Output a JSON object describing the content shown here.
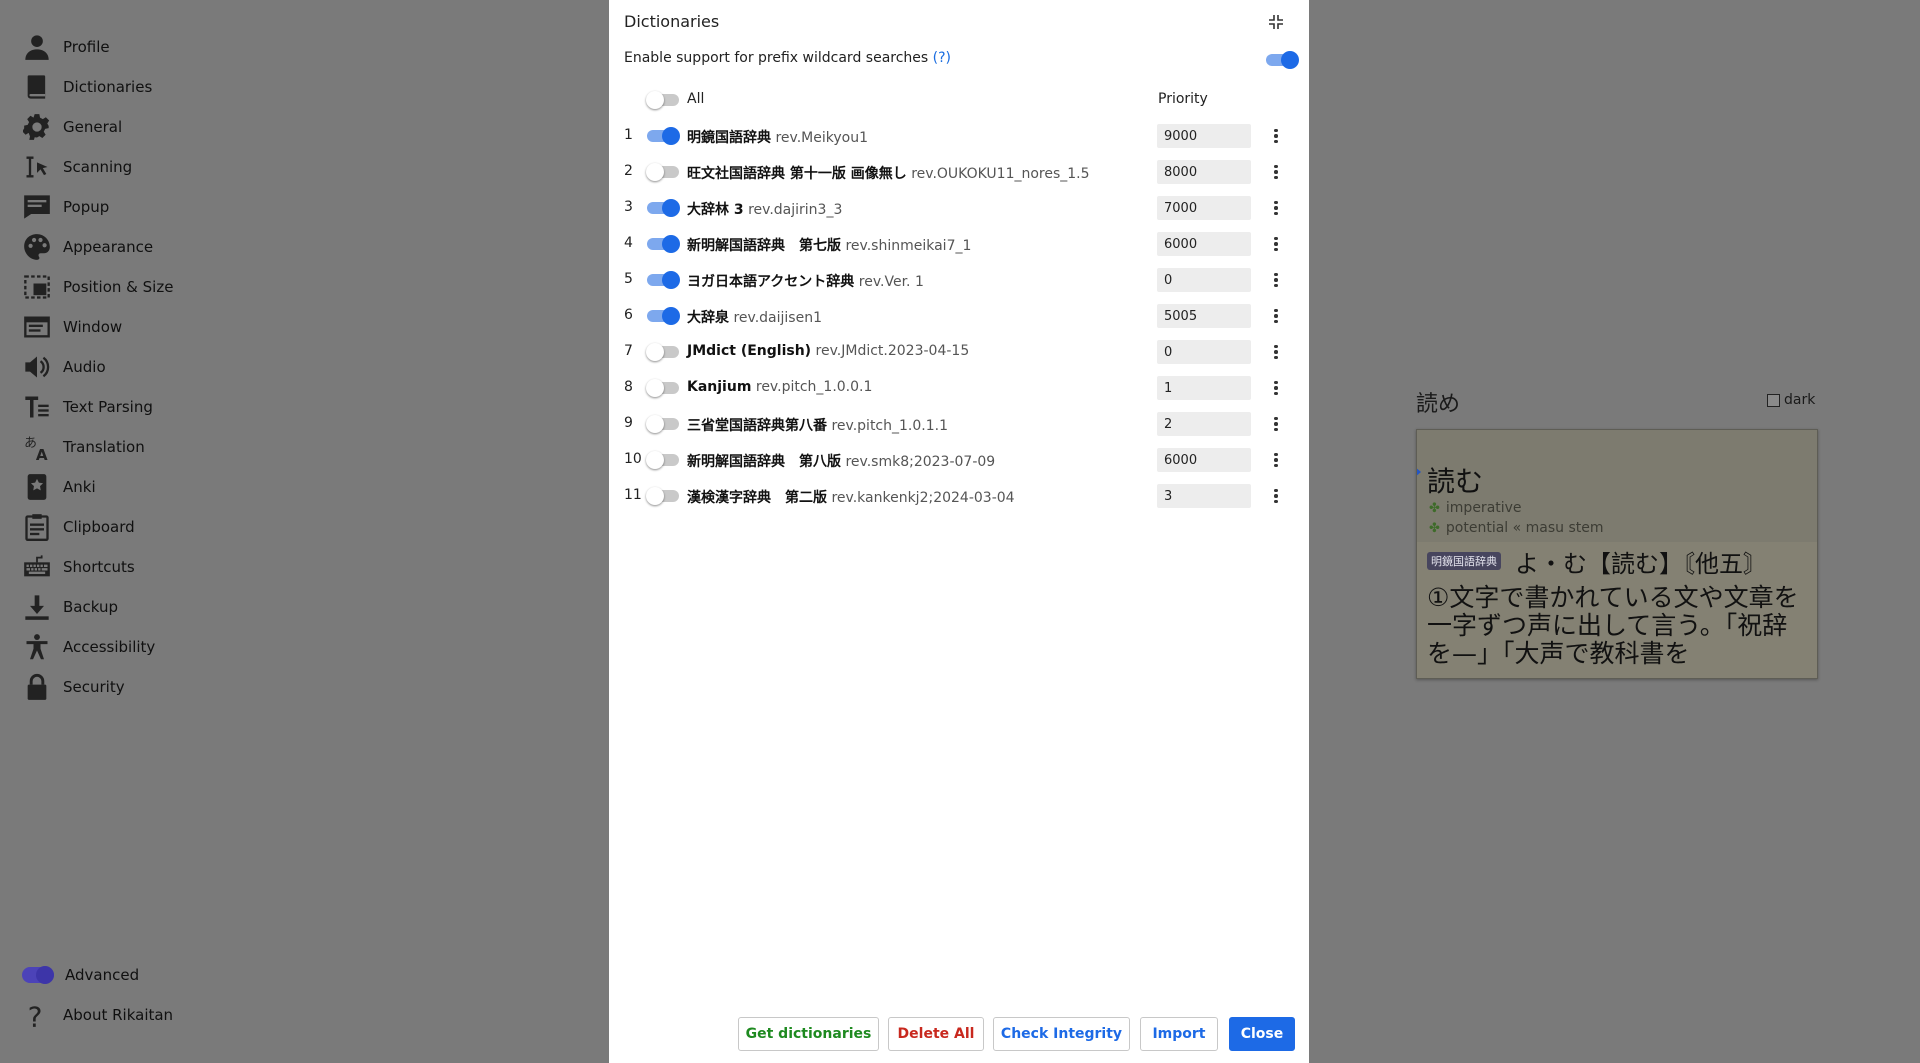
{
  "sidebar": {
    "items": [
      {
        "label": "Profile",
        "icon": "profile-icon"
      },
      {
        "label": "Dictionaries",
        "icon": "book-icon"
      },
      {
        "label": "General",
        "icon": "gear-icon"
      },
      {
        "label": "Scanning",
        "icon": "text-cursor-icon"
      },
      {
        "label": "Popup",
        "icon": "popup-icon"
      },
      {
        "label": "Appearance",
        "icon": "palette-icon"
      },
      {
        "label": "Position & Size",
        "icon": "resize-icon"
      },
      {
        "label": "Window",
        "icon": "window-icon"
      },
      {
        "label": "Audio",
        "icon": "speaker-icon"
      },
      {
        "label": "Text Parsing",
        "icon": "text-parsing-icon"
      },
      {
        "label": "Translation",
        "icon": "translate-icon"
      },
      {
        "label": "Anki",
        "icon": "anki-icon"
      },
      {
        "label": "Clipboard",
        "icon": "clipboard-icon"
      },
      {
        "label": "Shortcuts",
        "icon": "keyboard-icon"
      },
      {
        "label": "Backup",
        "icon": "download-icon"
      },
      {
        "label": "Accessibility",
        "icon": "accessibility-icon"
      },
      {
        "label": "Security",
        "icon": "lock-icon"
      }
    ],
    "advanced_label": "Advanced",
    "about_label": "About Rikaitan"
  },
  "preview": {
    "title": "読め",
    "dark_label": "dark",
    "term": "読む",
    "tags": [
      "imperative",
      "potential « masu stem"
    ],
    "dict_badge": "明鏡国語辞典",
    "reading": "よ・む【読む】〘他五〙",
    "definition": "①文字で書かれている文や文章を一字ずつ声に出して言う。「祝辞を—」「大声で教科書を"
  },
  "modal": {
    "title": "Dictionaries",
    "wildcard_label": "Enable support for prefix wildcard searches",
    "help_label": "(?)",
    "wildcard_enabled": true,
    "all_label": "All",
    "priority_label": "Priority",
    "dictionaries": [
      {
        "num": "1",
        "title": "明鏡国語辞典",
        "rev": "rev.Meikyou1",
        "enabled": true,
        "priority": "9000"
      },
      {
        "num": "2",
        "title": "旺文社国語辞典 第十一版 画像無し",
        "rev": "rev.OUKOKU11_nores_1.5",
        "enabled": false,
        "priority": "8000"
      },
      {
        "num": "3",
        "title": "大辞林 3",
        "rev": "rev.dajirin3_3",
        "enabled": true,
        "priority": "7000"
      },
      {
        "num": "4",
        "title": "新明解国語辞典　第七版",
        "rev": "rev.shinmeikai7_1",
        "enabled": true,
        "priority": "6000"
      },
      {
        "num": "5",
        "title": "ヨガ日本語アクセント辞典",
        "rev": "rev.Ver. 1",
        "enabled": true,
        "priority": "0"
      },
      {
        "num": "6",
        "title": "大辞泉",
        "rev": "rev.daijisen1",
        "enabled": true,
        "priority": "5005"
      },
      {
        "num": "7",
        "title": "JMdict (English)",
        "rev": "rev.JMdict.2023-04-15",
        "enabled": false,
        "priority": "0"
      },
      {
        "num": "8",
        "title": "Kanjium",
        "rev": "rev.pitch_1.0.0.1",
        "enabled": false,
        "priority": "1"
      },
      {
        "num": "9",
        "title": "三省堂国語辞典第八番",
        "rev": "rev.pitch_1.0.1.1",
        "enabled": false,
        "priority": "2"
      },
      {
        "num": "10",
        "title": "新明解国語辞典　第八版",
        "rev": "rev.smk8;2023-07-09",
        "enabled": false,
        "priority": "6000"
      },
      {
        "num": "11",
        "title": "漢検漢字辞典　第二版",
        "rev": "rev.kankenkj2;2024-03-04",
        "enabled": false,
        "priority": "3"
      }
    ],
    "buttons": {
      "get": "Get dictionaries",
      "delete_all": "Delete All",
      "check_integrity": "Check Integrity",
      "import": "Import",
      "close": "Close"
    }
  },
  "colors": {
    "accent": "#1d6ae6",
    "get_green": "#1e8a20",
    "delete_red": "#c8281e",
    "backdrop": "#7a7a7a"
  }
}
